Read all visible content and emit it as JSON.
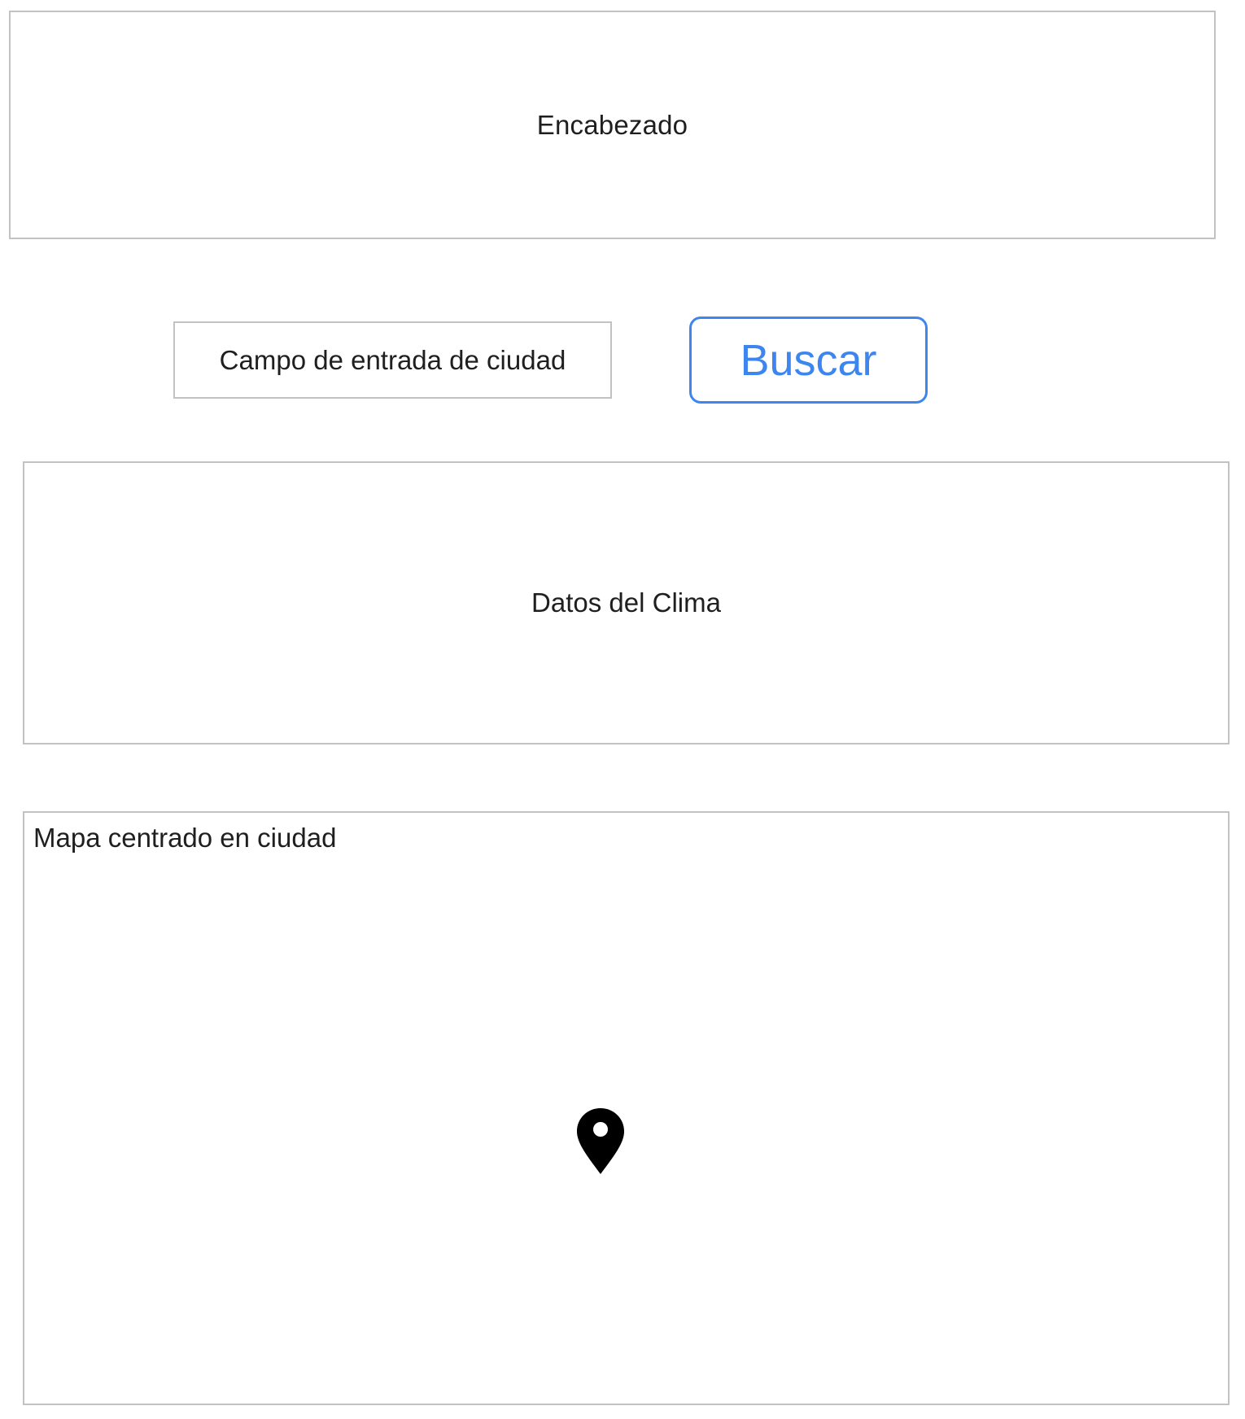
{
  "header": {
    "label": "Encabezado"
  },
  "search": {
    "placeholder": "Campo de entrada de ciudad",
    "button_label": "Buscar"
  },
  "weather": {
    "label": "Datos del Clima"
  },
  "map": {
    "label": "Mapa centrado en ciudad",
    "marker_icon": "map-pin-icon"
  },
  "colors": {
    "accent": "#3d86ef",
    "border": "#c2c2c2",
    "text": "#1f1f1f",
    "background": "#ffffff"
  }
}
